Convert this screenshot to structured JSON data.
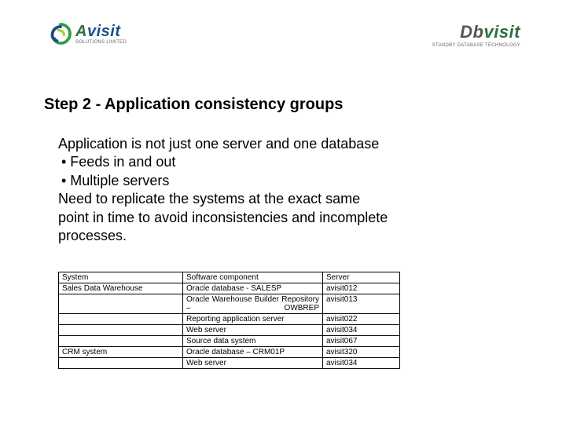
{
  "logos": {
    "left": {
      "brand_a": "A",
      "brand_visit": "visit",
      "tagline": "SOLUTIONS LIMITED"
    },
    "right": {
      "brand_db": "Db",
      "brand_visit": "visit",
      "tagline": "STANDBY DATABASE TECHNOLOGY"
    }
  },
  "title": "Step 2 - Application consistency groups",
  "body": {
    "line1": "Application is not just one server and one database",
    "bullet1": "• Feeds in and out",
    "bullet2": "• Multiple servers",
    "line2a": "Need to replicate the systems at the exact same",
    "line2b": "point in time to avoid inconsistencies and incomplete",
    "line2c": "processes."
  },
  "table": {
    "headers": {
      "c1": "System",
      "c2": "Software component",
      "c3": "Server"
    },
    "rows": [
      {
        "c1": "Sales Data Warehouse",
        "c2": "Oracle database - SALESP",
        "c3": "avisit012"
      },
      {
        "c1": "",
        "c2": "Oracle Warehouse Builder Repository – OWBREP",
        "c3": "avisit013"
      },
      {
        "c1": "",
        "c2": "Reporting application server",
        "c3": "avisit022"
      },
      {
        "c1": "",
        "c2": "Web server",
        "c3": "avisit034"
      },
      {
        "c1": "",
        "c2": "Source data system",
        "c3": "avisit067"
      },
      {
        "c1": "CRM system",
        "c2": "Oracle database – CRM01P",
        "c3": "avisit320"
      },
      {
        "c1": "",
        "c2": "Web server",
        "c3": "avisit034"
      }
    ]
  }
}
